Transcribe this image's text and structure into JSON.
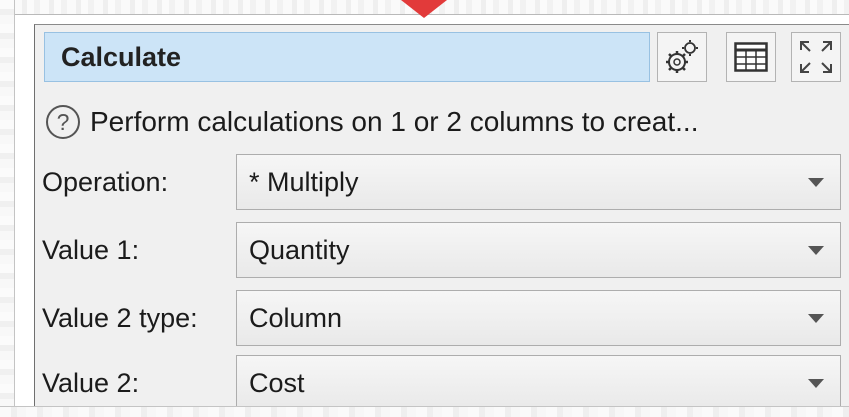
{
  "panel": {
    "title": "Calculate",
    "help_text": "Perform calculations on 1 or 2 columns to creat...",
    "help_icon_glyph": "?",
    "toolbar": [
      {
        "name": "settings-icon"
      },
      {
        "name": "table-icon"
      },
      {
        "name": "maximize-icon"
      }
    ]
  },
  "fields": [
    {
      "label": "Operation:",
      "value": "* Multiply"
    },
    {
      "label": "Value 1:",
      "value": "Quantity"
    },
    {
      "label": "Value 2 type:",
      "value": "Column"
    },
    {
      "label": "Value 2:",
      "value": "Cost"
    }
  ],
  "colors": {
    "title_bar": "#cce4f7",
    "panel_bg": "#f0f0f0",
    "arrow_accent": "#e23a3a"
  }
}
